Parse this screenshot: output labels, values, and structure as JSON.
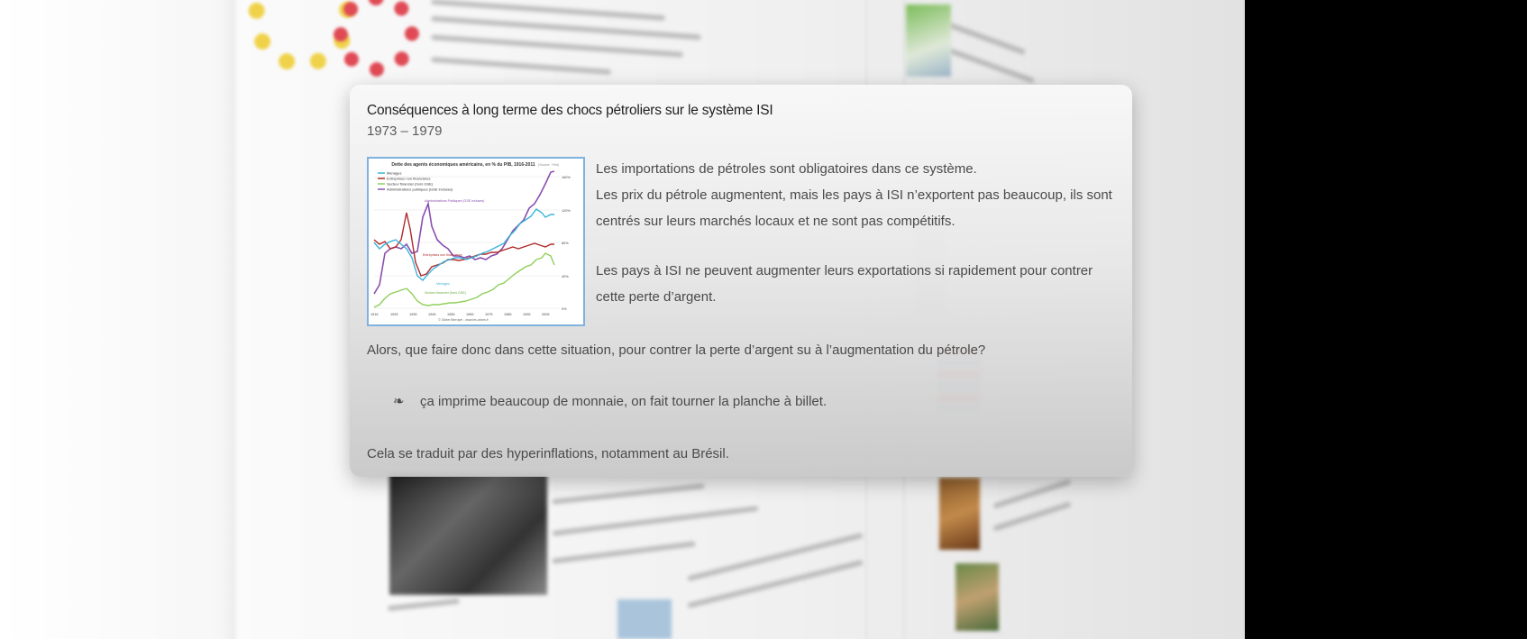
{
  "popup": {
    "title": "Conséquences à long terme des chocs pétroliers sur le système ISI",
    "dates": "1973 – 1979",
    "paragraph1_line1": "Les importations de pétroles sont obligatoires dans ce système.",
    "paragraph1_line2": "Les prix du pétrole augmentent, mais les pays à ISI n’exportent pas beaucoup, ils sont centrés sur leurs marchés locaux et ne sont pas compétitifs.",
    "paragraph2": "Les pays à ISI ne peuvent augmenter leurs exportations si rapidement pour contrer cette perte d’argent.",
    "question": "Alors, que faire donc dans cette situation, pour contrer la perte d’argent su à l’augmentation du pétrole?",
    "bullet_glyph": "❧",
    "bullet_text": "ça imprime beaucoup de monnaie, on fait tourner la planche à billet.",
    "conclusion": "Cela se traduit par des hyperinflations, notamment au Brésil."
  },
  "thumbnail": {
    "title": "Dette des agents économiques américains, en % du PIB, 1916-2011",
    "source": "(Source : Fed)",
    "legend": [
      "Ménages",
      "Entreprises non financières",
      "Secteur financier (hors GSE)",
      "Administrations publiques (GSE incluses)"
    ],
    "annotations": {
      "admin": "Administrations Publiques (GSE incluses)",
      "entreprises": "Entreprises non financières",
      "menages": "Ménages",
      "financier": "Secteur financier (hors GSE)"
    },
    "x_ticks": [
      "1916",
      "1925",
      "1935",
      "1945",
      "1955",
      "1965",
      "1975",
      "1985",
      "1995",
      "2005"
    ],
    "y_ticks": [
      "160%",
      "120%",
      "80%",
      "40%",
      "0%"
    ],
    "credit": "© Olivier Berruyer - www.les-crises.fr",
    "colors": {
      "menages": "#3bb4d8",
      "entreprises": "#b02a2a",
      "financier": "#8fcf5a",
      "admin": "#8a4fb0"
    }
  }
}
